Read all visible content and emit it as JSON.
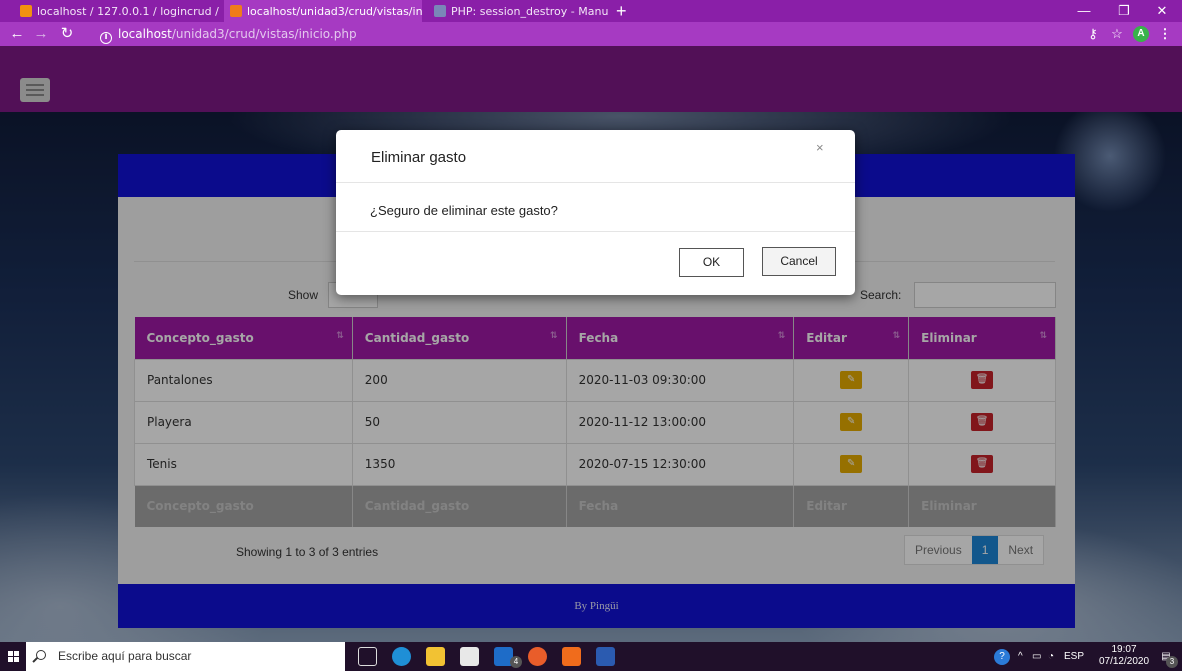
{
  "browser": {
    "tabs": [
      {
        "label": "localhost / 127.0.0.1 / logincrud /",
        "active": false
      },
      {
        "label": "localhost/unidad3/crud/vistas/in",
        "active": true
      },
      {
        "label": "PHP: session_destroy - Manual",
        "active": false
      }
    ],
    "url_host": "localhost",
    "url_path": "/unidad3/crud/vistas/inicio.php",
    "profile_initial": "A"
  },
  "table_controls": {
    "show_label": "Show",
    "search_label": "Search:"
  },
  "table": {
    "columns": [
      "Concepto_gasto",
      "Cantidad_gasto",
      "Fecha",
      "Editar",
      "Eliminar"
    ],
    "rows": [
      {
        "concepto": "Pantalones",
        "cantidad": "200",
        "fecha": "2020-11-03 09:30:00"
      },
      {
        "concepto": "Playera",
        "cantidad": "50",
        "fecha": "2020-11-12 13:00:00"
      },
      {
        "concepto": "Tenis",
        "cantidad": "1350",
        "fecha": "2020-07-15 12:30:00"
      }
    ]
  },
  "table_info": "Showing 1 to 3 of 3 entries",
  "pagination": {
    "previous": "Previous",
    "current": "1",
    "next": "Next"
  },
  "footer": {
    "text": "By Pingüi"
  },
  "modal": {
    "title": "Eliminar gasto",
    "close": "×",
    "body": "¿Seguro de eliminar este gasto?",
    "ok": "OK",
    "cancel": "Cancel"
  },
  "taskbar": {
    "search_placeholder": "Escribe aquí para buscar",
    "language": "ESP",
    "time": "19:07",
    "date": "07/12/2020",
    "notification_count": "3",
    "mail_badge": "4"
  }
}
